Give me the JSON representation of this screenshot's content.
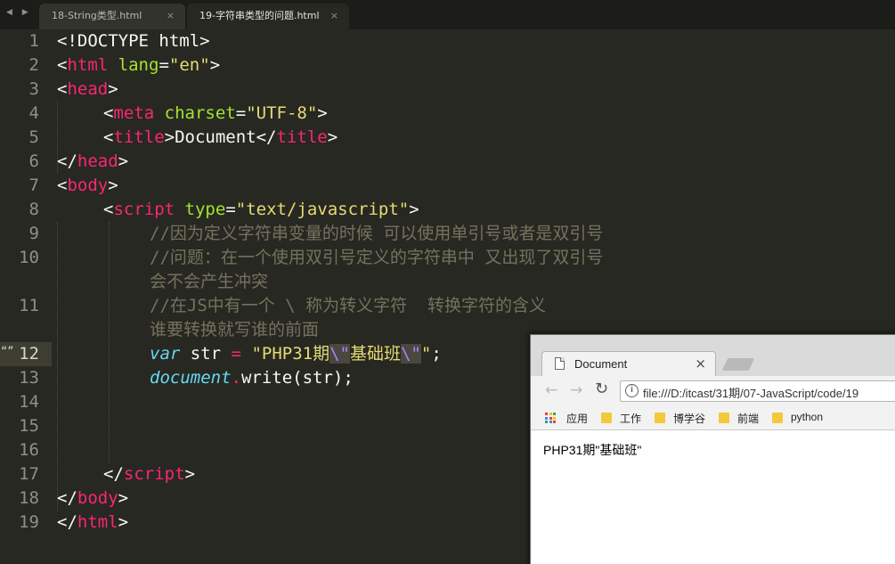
{
  "editor": {
    "nav_arrows": "◀ ▶",
    "tabs": [
      {
        "label": "18-String类型.html",
        "close": "×"
      },
      {
        "label": "19-字符串类型的问题.html",
        "close": "×"
      }
    ],
    "line_numbers": [
      "1",
      "2",
      "3",
      "4",
      "5",
      "6",
      "7",
      "8",
      "9",
      "10",
      "11",
      "12",
      "13",
      "14",
      "15",
      "16",
      "17",
      "18",
      "19"
    ],
    "active_line_marker": "“”",
    "code": {
      "l1": "<!DOCTYPE html>",
      "l2_open": "<",
      "l2_tag": "html",
      "l2_attr": "lang",
      "l2_eq": "=",
      "l2_val": "\"en\"",
      "l2_close": ">",
      "l3_open": "<",
      "l3_tag": "head",
      "l3_close": ">",
      "l4_open": "<",
      "l4_tag": "meta",
      "l4_attr": "charset",
      "l4_eq": "=",
      "l4_val": "\"UTF-8\"",
      "l4_close": ">",
      "l5_open": "<",
      "l5_tag": "title",
      "l5_mid": ">Document</",
      "l5_tag2": "title",
      "l5_close": ">",
      "l6_open": "</",
      "l6_tag": "head",
      "l6_close": ">",
      "l7_open": "<",
      "l7_tag": "body",
      "l7_close": ">",
      "l8_open": "<",
      "l8_tag": "script",
      "l8_attr": "type",
      "l8_eq": "=",
      "l8_val": "\"text/javascript\"",
      "l8_close": ">",
      "l9": "//因为定义字符串变量的时候 可以使用单引号或者是双引号",
      "l10a": "//问题：在一个使用双引号定义的字符串中 又出现了双引号",
      "l10b": "会不会产生冲突",
      "l11a": "//在JS中有一个 \\ 称为转义字符  转换字符的含义",
      "l11b": "谁要转换就写谁的前面",
      "l12_var": "var",
      "l12_name": " str ",
      "l12_eq": "=",
      "l12_sp": " ",
      "l12_s1": "\"PHP31期",
      "l12_e1": "\\\"",
      "l12_s2": "基础班",
      "l12_e2": "\\\"",
      "l12_s3": "\"",
      "l12_end": ";",
      "l13_doc": "document",
      "l13_dot": ".",
      "l13_fn": "write",
      "l13_args": "(str);",
      "l17_open": "</",
      "l17_tag": "script",
      "l17_close": ">",
      "l18_open": "</",
      "l18_tag": "body",
      "l18_close": ">",
      "l19_open": "</",
      "l19_tag": "html",
      "l19_close": ">"
    }
  },
  "browser": {
    "tab_title": "Document",
    "tab_close": "×",
    "back": "←",
    "forward": "→",
    "reload": "↻",
    "info": "i",
    "url": "file:///D:/itcast/31期/07-JavaScript/code/19",
    "bookmarks": {
      "apps": "应用",
      "folders": [
        "工作",
        "博学谷",
        "前端",
        "python"
      ]
    },
    "output": "PHP31期\"基础班\""
  },
  "colors": {
    "editor_bg": "#272822",
    "tag": "#f92672",
    "attr": "#a6e22e",
    "string": "#e6db74",
    "comment": "#75715e",
    "keyword": "#66d9ef",
    "escape": "#ae81ff",
    "folder": "#f3c93b"
  }
}
